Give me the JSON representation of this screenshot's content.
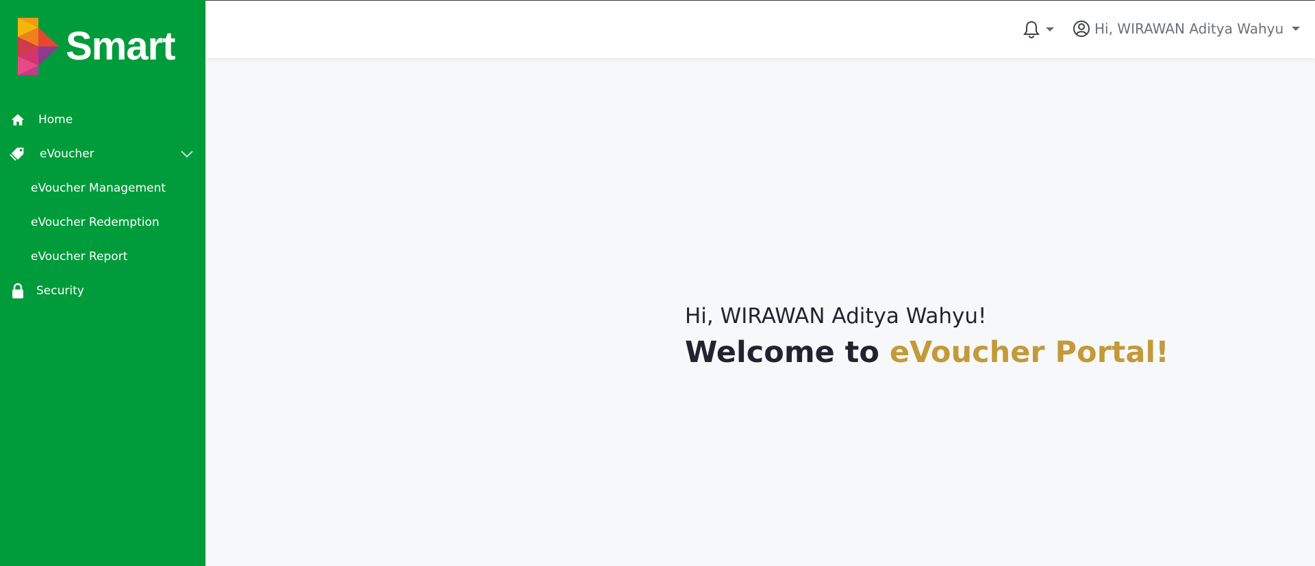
{
  "brand": {
    "name": "Smart"
  },
  "sidebar": {
    "items": [
      {
        "label": "Home",
        "icon": "home-icon"
      },
      {
        "label": "eVoucher",
        "icon": "tag-icon",
        "expanded": true,
        "children": [
          {
            "label": "eVoucher Management"
          },
          {
            "label": "eVoucher Redemption"
          },
          {
            "label": "eVoucher Report"
          }
        ]
      },
      {
        "label": "Security",
        "icon": "lock-icon"
      }
    ]
  },
  "topbar": {
    "notifications_icon": "bell-icon",
    "user_icon": "user-circle-icon",
    "user_greeting": "Hi, WIRAWAN Aditya Wahyu"
  },
  "main": {
    "greeting": "Hi, WIRAWAN Aditya Wahyu!",
    "welcome_lead": "Welcome to ",
    "welcome_accent": "eVoucher Portal!"
  },
  "colors": {
    "sidebar": "#009b3a",
    "accent": "#c39a3a",
    "background": "#f7f8fa"
  }
}
